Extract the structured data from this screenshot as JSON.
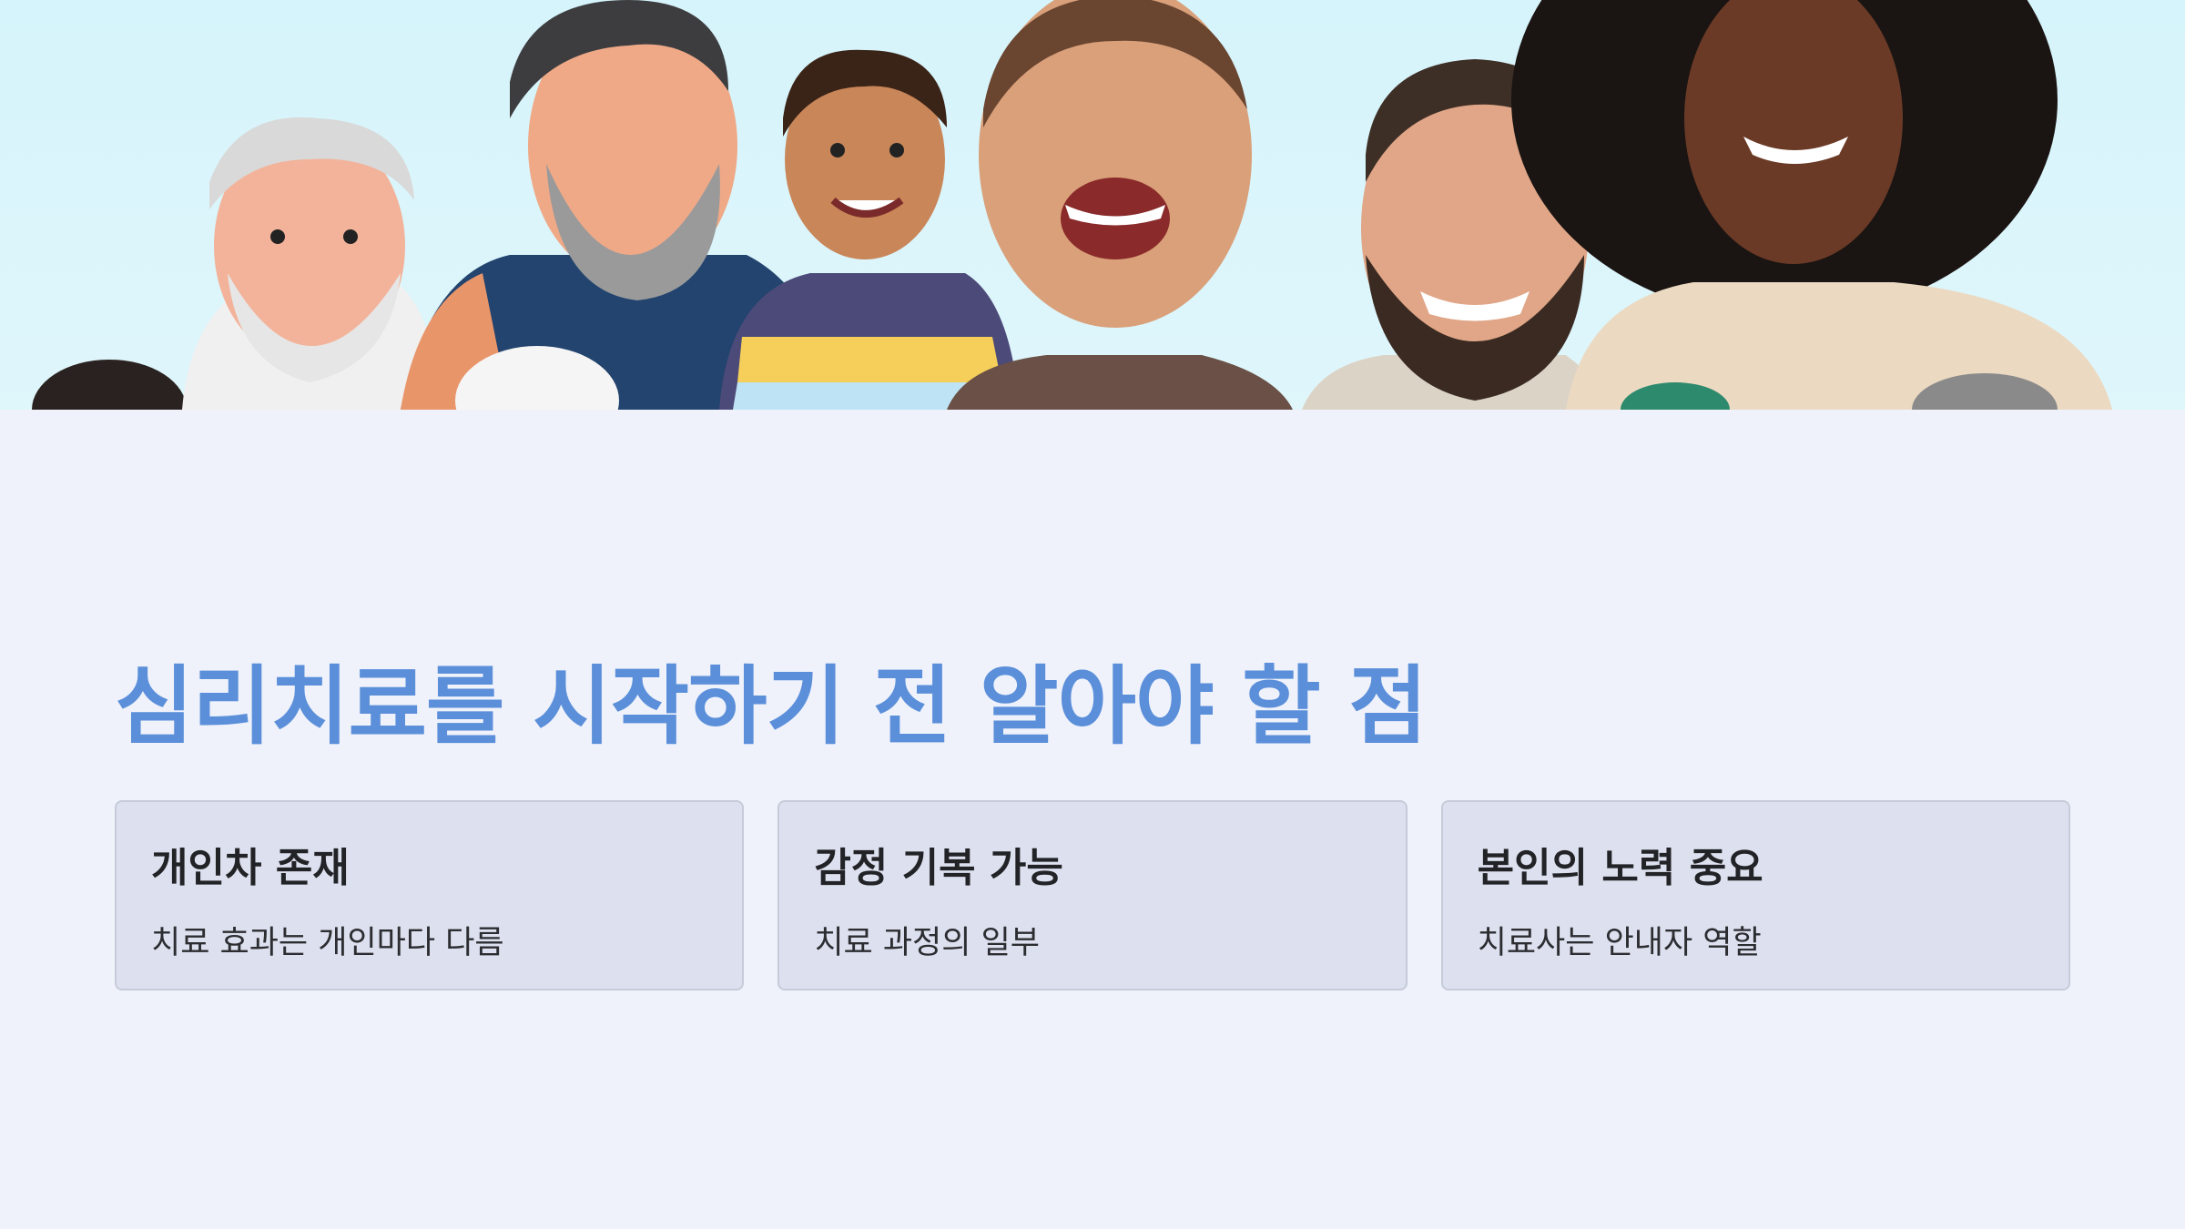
{
  "banner": {
    "image_icon": "group-of-diverse-smiling-people-illustration",
    "sky_color": "#d6f4fb"
  },
  "title": "심리치료를 시작하기 전 알아야 할 점",
  "cards": [
    {
      "title": "개인차 존재",
      "desc": "치료 효과는 개인마다 다름"
    },
    {
      "title": "감정 기복 가능",
      "desc": "치료 과정의 일부"
    },
    {
      "title": "본인의 노력 중요",
      "desc": "치료사는 안내자 역할"
    }
  ],
  "colors": {
    "background": "#eff2fb",
    "title": "#5b8fd9",
    "card_bg": "#dde1ef",
    "card_border": "#c6cbda"
  }
}
